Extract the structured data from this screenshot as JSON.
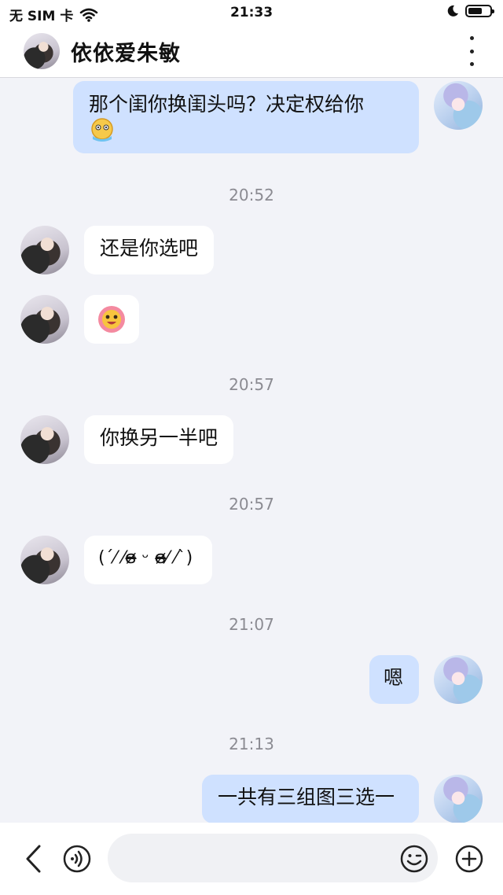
{
  "status_bar": {
    "carrier": "无 SIM 卡",
    "time": "21:33"
  },
  "header": {
    "contact_name": "依依爱朱敏"
  },
  "messages": {
    "m1_text": "那个闺你换闺头吗？决定权给你",
    "ts1": "20:52",
    "m2_text": "还是你选吧",
    "ts2": "20:57",
    "m4_text": "你换另一半吧",
    "ts3": "20:57",
    "m5_text": "(ˊ⁄ ⁄ɞ̴̶̷ ᵕ ɞ̴̶̷⁄ ⁄ˋ)",
    "ts4": "21:07",
    "m6_text": "嗯",
    "ts5": "21:13",
    "m7_text": "一共有三组图三选一"
  },
  "icons": {
    "back": "chevron-left-icon",
    "voice": "voice-icon",
    "emoji": "emoji-icon",
    "plus": "plus-circle-icon"
  },
  "colors": {
    "outgoing_bubble": "#cfe1ff",
    "incoming_bubble": "#ffffff",
    "chat_background": "#f2f3f8"
  }
}
